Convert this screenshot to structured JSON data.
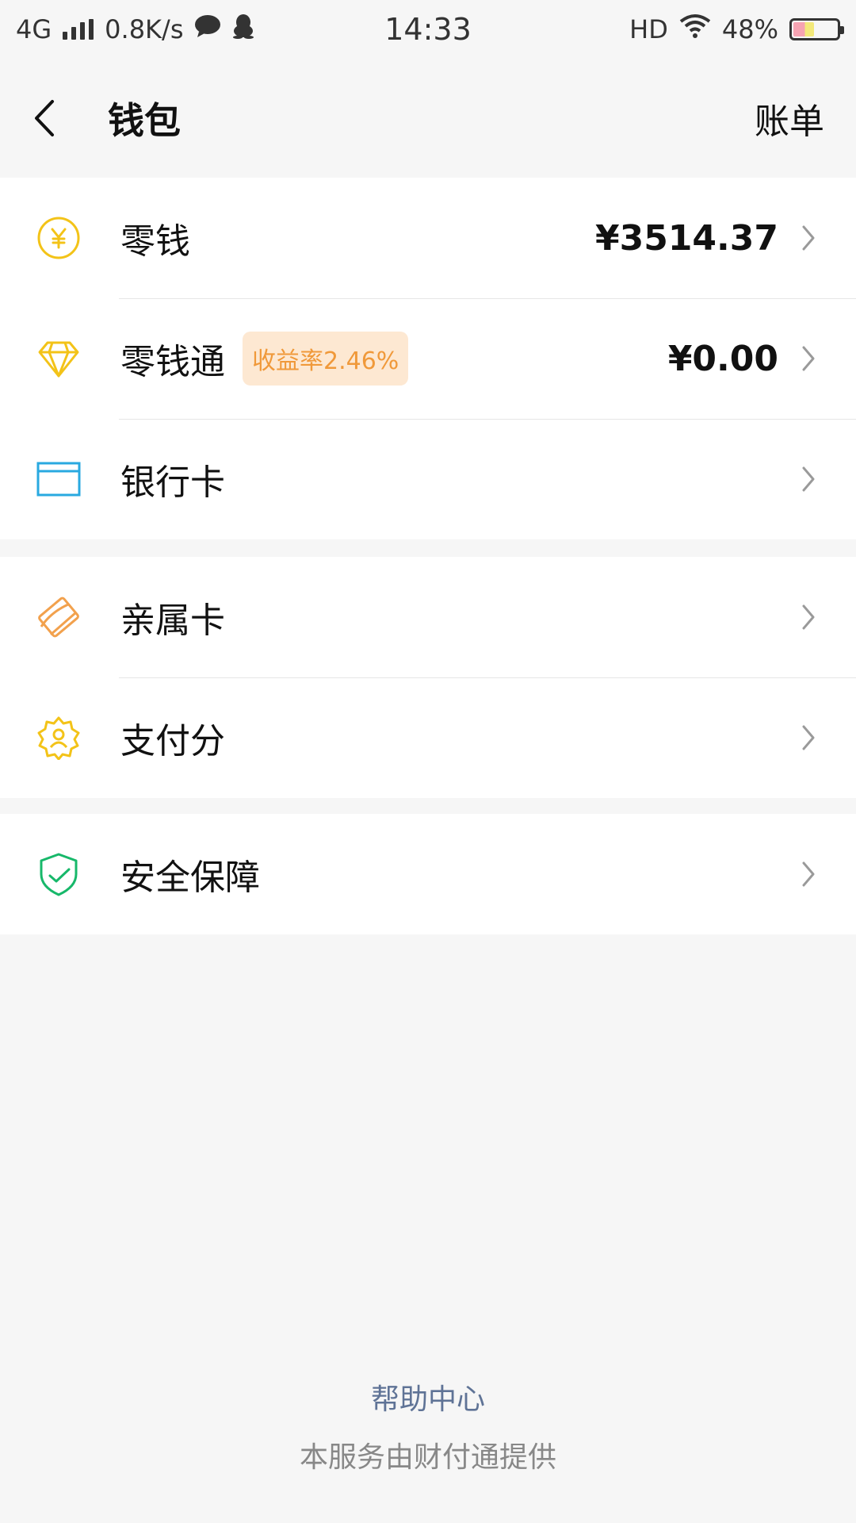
{
  "status_bar": {
    "network": "4G",
    "speed": "0.8K/s",
    "time": "14:33",
    "hd": "HD",
    "battery_percent": "48%",
    "battery_level": 0.48,
    "icons": [
      "signal-icon",
      "chat-bubble-icon",
      "qq-penguin-icon",
      "wifi-icon",
      "battery-icon"
    ]
  },
  "nav": {
    "title": "钱包",
    "action": "账单"
  },
  "group1": {
    "items": [
      {
        "label": "零钱",
        "value": "¥3514.37",
        "icon": "yuan-coin-icon",
        "color": "#f3c318"
      },
      {
        "label": "零钱通",
        "badge": "收益率2.46%",
        "value": "¥0.00",
        "icon": "diamond-icon",
        "color": "#f3c318"
      },
      {
        "label": "银行卡",
        "icon": "bank-card-icon",
        "color": "#29a9e0"
      }
    ]
  },
  "group2": {
    "items": [
      {
        "label": "亲属卡",
        "icon": "family-card-icon",
        "color": "#f2a14d"
      },
      {
        "label": "支付分",
        "icon": "pay-score-icon",
        "color": "#f3c318"
      }
    ]
  },
  "group3": {
    "items": [
      {
        "label": "安全保障",
        "icon": "security-shield-icon",
        "color": "#17b86a"
      }
    ]
  },
  "footer": {
    "help": "帮助中心",
    "note": "本服务由财付通提供"
  }
}
